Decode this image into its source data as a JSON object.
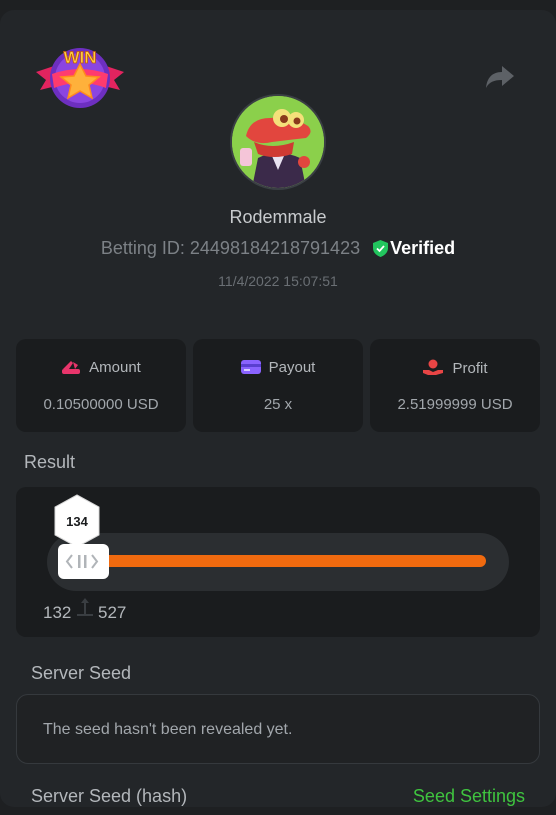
{
  "header": {
    "badge_text": "WIN",
    "share_icon": "share-icon"
  },
  "profile": {
    "username": "Rodemmale",
    "betting_id_label": "Betting ID: 24498184218791423",
    "verified_label": "Verified",
    "timestamp": "11/4/2022 15:07:51"
  },
  "stats": [
    {
      "label": "Amount",
      "value": "0.10500000 USD",
      "icon": "amount-icon",
      "color": "#e8356b"
    },
    {
      "label": "Payout",
      "value": "25 x",
      "icon": "payout-icon",
      "color": "#8a63ff"
    },
    {
      "label": "Profit",
      "value": "2.51999999 USD",
      "icon": "profit-icon",
      "color": "#e84545"
    }
  ],
  "result": {
    "section_label": "Result",
    "current_value": "134",
    "range_low": "132",
    "range_high": "527",
    "accent": "#f06a0f"
  },
  "server_seed": {
    "label": "Server Seed",
    "message": "The seed hasn't been revealed yet."
  },
  "server_seed_hash": {
    "label": "Server Seed (hash)",
    "settings_link": "Seed Settings",
    "link_color": "#3fc43f"
  }
}
